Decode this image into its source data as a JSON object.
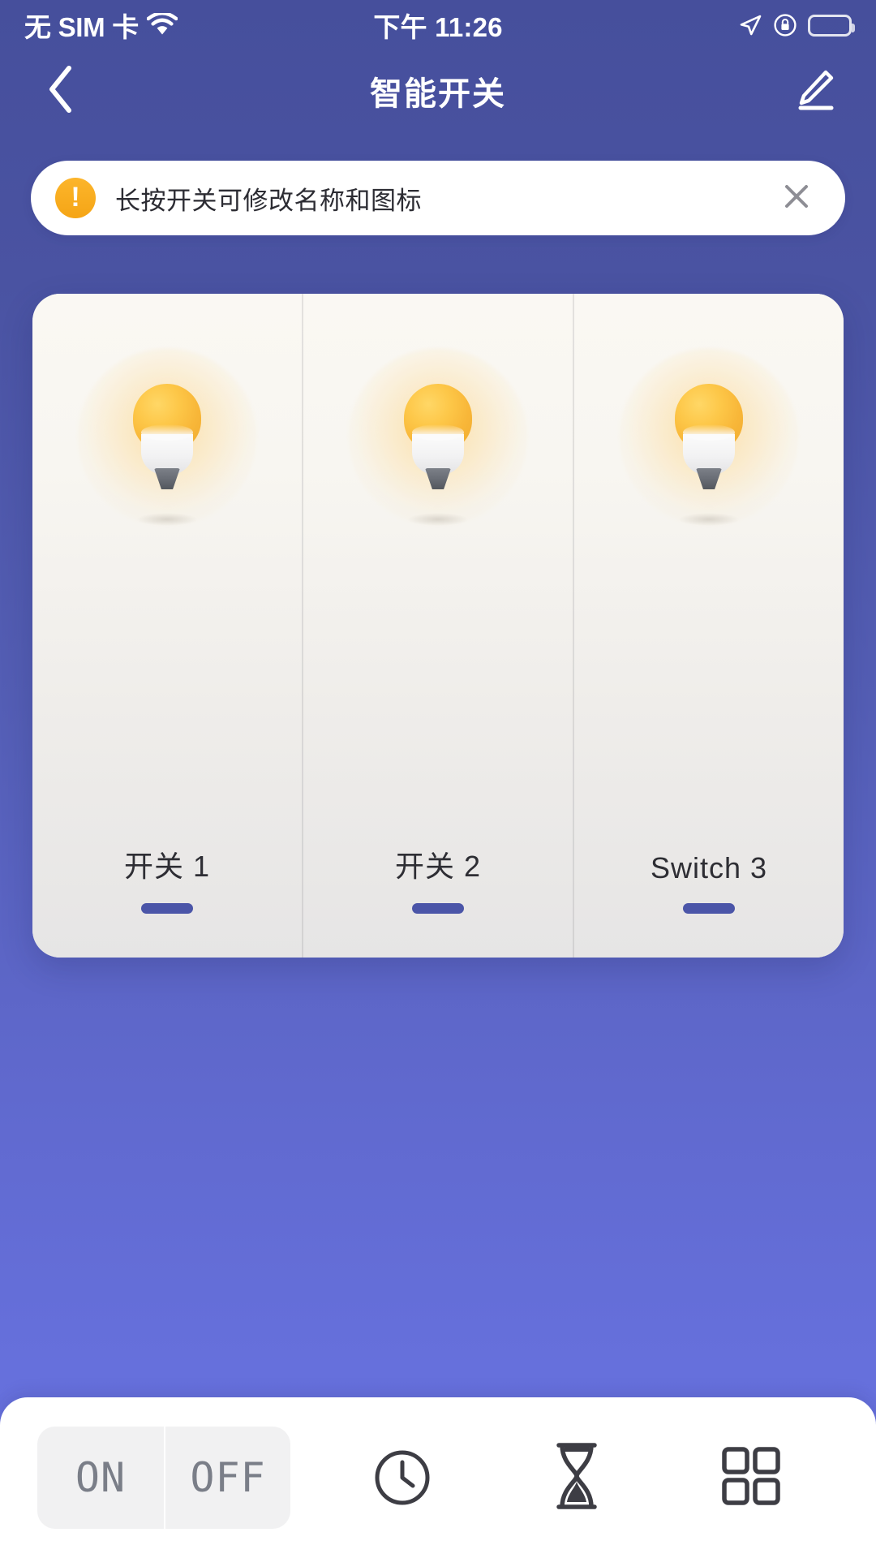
{
  "status_bar": {
    "carrier": "无 SIM 卡",
    "wifi_icon": "wifi-icon",
    "time": "下午 11:26",
    "location_icon": "location-arrow-icon",
    "lock_icon": "rotation-lock-icon",
    "battery_icon": "battery-icon"
  },
  "nav": {
    "back_icon": "chevron-left-icon",
    "title": "智能开关",
    "edit_icon": "pencil-edit-icon"
  },
  "banner": {
    "icon": "exclamation-circle-icon",
    "bang": "!",
    "text": "长按开关可修改名称和图标",
    "close_icon": "close-x-icon"
  },
  "panel": {
    "gangs": [
      {
        "label": "开关 1",
        "icon": "light-bulb-icon",
        "state_indicator": "on"
      },
      {
        "label": "开关 2",
        "icon": "light-bulb-icon",
        "state_indicator": "on"
      },
      {
        "label": "Switch 3",
        "icon": "light-bulb-icon",
        "state_indicator": "on"
      }
    ]
  },
  "bottom_bar": {
    "on_label": "ON",
    "off_label": "OFF",
    "timer_icon": "clock-icon",
    "countdown_icon": "hourglass-icon",
    "grid_icon": "grid-squares-icon"
  },
  "colors": {
    "bg_top": "#464F9C",
    "bg_bottom": "#6A74E2",
    "accent_blue": "#4B55A8",
    "warning_orange": "#F5A516",
    "bulb_amber": "#F8B739",
    "panel_light": "#FAF8F3"
  }
}
